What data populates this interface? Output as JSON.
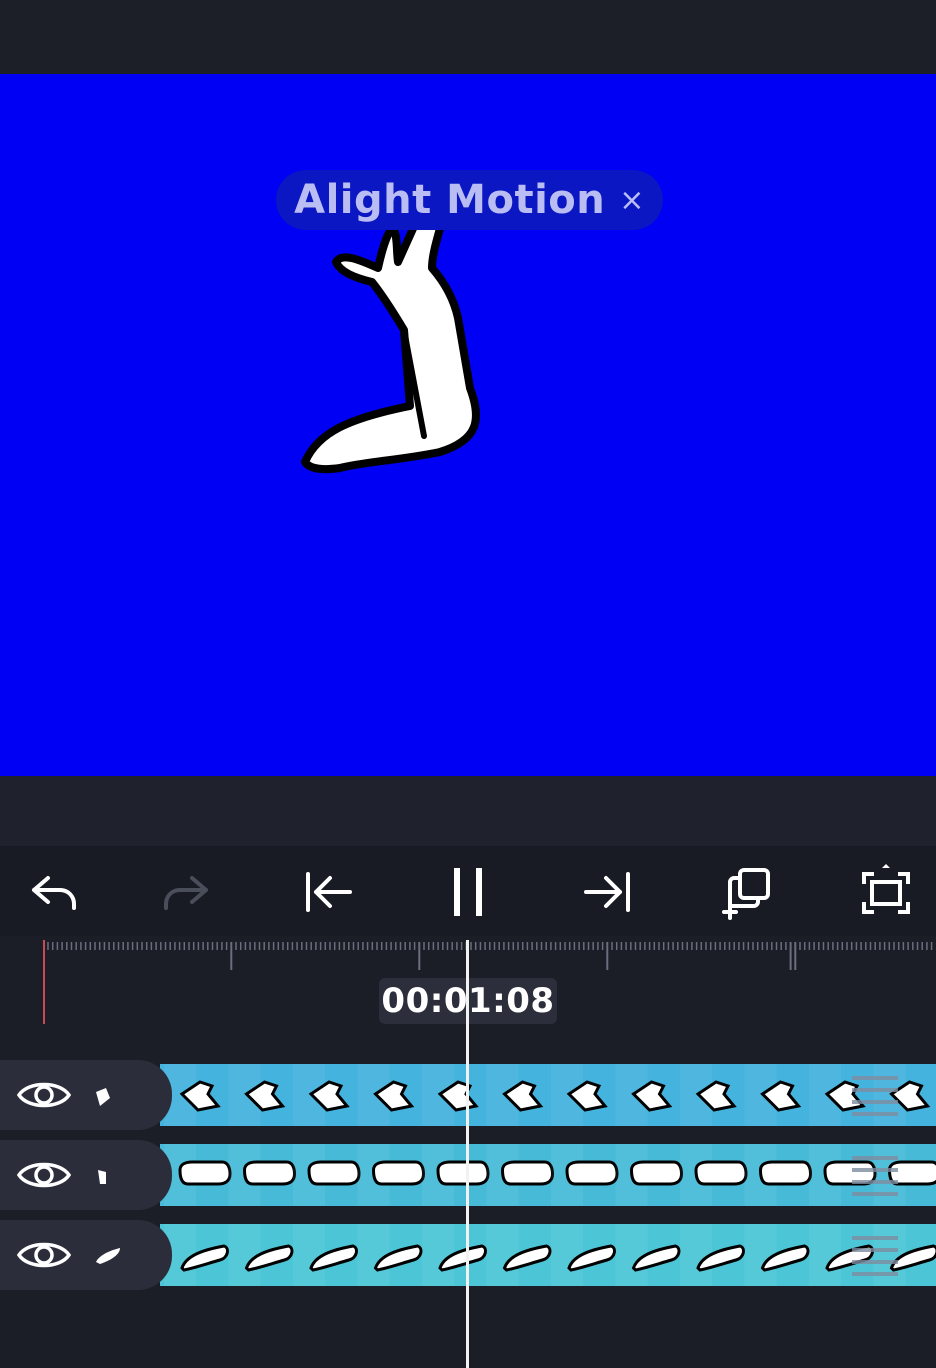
{
  "app": {
    "watermark_text": "Alight Motion",
    "watermark_close": "×"
  },
  "colors": {
    "canvas_background": "#0000f4",
    "app_background": "#1b1d27",
    "clip_color": "#4cc0df",
    "playhead": "#f2f2f2",
    "start_marker": "#c94a54"
  },
  "toolbar": {
    "buttons": [
      {
        "name": "undo-button",
        "icon": "undo-icon"
      },
      {
        "name": "redo-button",
        "icon": "redo-icon",
        "disabled": true
      },
      {
        "name": "jump-to-start-button",
        "icon": "skip-to-start-icon"
      },
      {
        "name": "pause-button",
        "icon": "pause-icon"
      },
      {
        "name": "jump-to-end-button",
        "icon": "skip-to-end-icon"
      },
      {
        "name": "add-layer-button",
        "icon": "add-layer-icon"
      },
      {
        "name": "fullscreen-button",
        "icon": "fullscreen-icon"
      }
    ]
  },
  "timeline": {
    "timecode": "00:01:08",
    "tracks": [
      {
        "name": "hand-layer",
        "visible": true,
        "thumb": "hand-shape-icon"
      },
      {
        "name": "forearm-layer",
        "visible": true,
        "thumb": "forearm-shape-icon"
      },
      {
        "name": "upper-arm-layer",
        "visible": true,
        "thumb": "upper-arm-shape-icon"
      }
    ]
  }
}
